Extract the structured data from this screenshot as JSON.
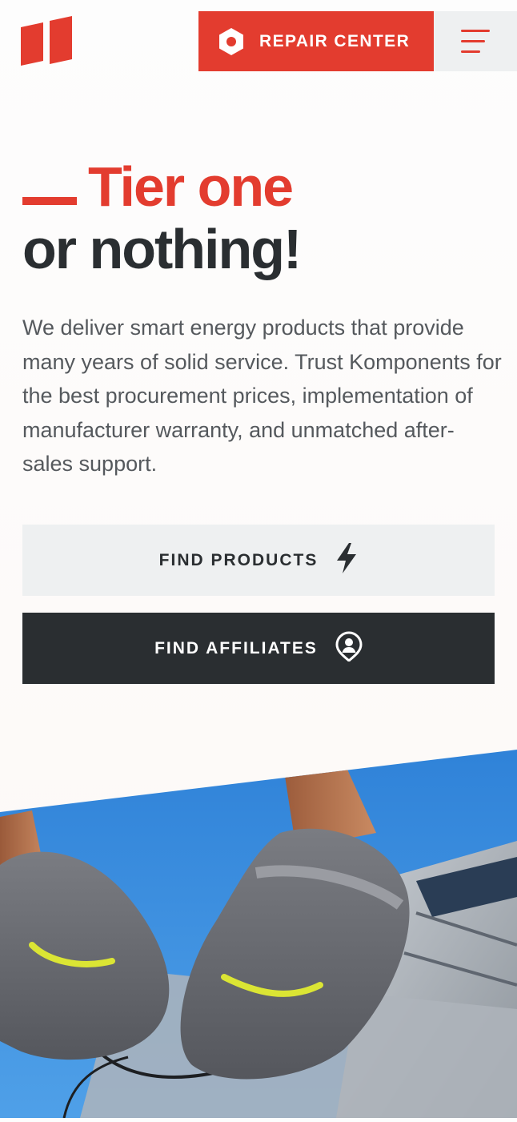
{
  "header": {
    "logo_icon": "brand-logo-icon",
    "repair_button": {
      "label": "REPAIR CENTER",
      "icon": "hexagon-bolt-icon"
    },
    "menu_button": {
      "icon": "hamburger-menu-icon"
    }
  },
  "hero": {
    "headline_line1": "Tier one",
    "headline_line2": "or nothing!",
    "intro": "We deliver smart energy products that provide many years of solid service. Trust Komponents for the best procurement prices, implementation of manufacturer warranty, and unmatched after-sales support.",
    "find_products": {
      "label": "FIND PRODUCTS",
      "icon": "lightning-bolt-icon"
    },
    "find_affiliates": {
      "label": "FIND AFFILIATES",
      "icon": "location-user-pin-icon"
    }
  },
  "colors": {
    "accent": "#e33c2f",
    "dark": "#2a2e31",
    "light_button": "#eef0f1",
    "body_text": "#55595d",
    "sky": "#2f82d8",
    "glove": "#6b6d73",
    "glove_print": "#dbe534"
  }
}
